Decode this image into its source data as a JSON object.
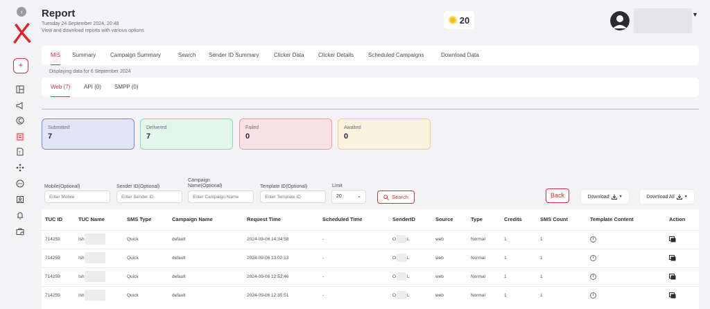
{
  "sidebar": {
    "collapse_icon": "chevron-right-icon",
    "add_label": "+",
    "icons": [
      "dashboard-icon",
      "megaphone-icon",
      "currency-icon",
      "report-icon",
      "template-icon",
      "network-icon",
      "chat-icon",
      "contact-icon",
      "bell-icon",
      "briefcase-icon"
    ]
  },
  "header": {
    "title": "Report",
    "date": "Tuesday 24 September 2024, 20:48",
    "subtitle": "View and download reports with various options",
    "credits": "20"
  },
  "tabs": [
    {
      "label": "MIS",
      "active": true
    },
    {
      "label": "Summary"
    },
    {
      "label": "Campaign Summary"
    },
    {
      "label": "Search"
    },
    {
      "label": "Sender ID Summary"
    },
    {
      "label": "Clicker Data"
    },
    {
      "label": "Clicker Details"
    },
    {
      "label": "Scheduled Campaigns"
    },
    {
      "label": "Download Data"
    }
  ],
  "display_info": "Displaying data for 6 September 2024",
  "subtabs": [
    {
      "label": "Web (7)",
      "active": true
    },
    {
      "label": "API (0)"
    },
    {
      "label": "SMPP (0)"
    }
  ],
  "stats": [
    {
      "label": "Submitted",
      "value": "7",
      "bg": "#e3e5f7",
      "border": "#7b83d8"
    },
    {
      "label": "Delivered",
      "value": "7",
      "bg": "#e2f6ec",
      "border": "#8bd9b0"
    },
    {
      "label": "Failed",
      "value": "0",
      "bg": "#f9e1e6",
      "border": "#e79aa9"
    },
    {
      "label": "Awaited",
      "value": "0",
      "bg": "#faf1de",
      "border": "#ebcf8f"
    }
  ],
  "filters": {
    "mobile_label": "Mobile(Optional)",
    "mobile_placeholder": "Enter Mobile",
    "sender_label": "Sender ID(Optional)",
    "sender_placeholder": "Enter Sender ID",
    "campaign_label_1": "Campaign",
    "campaign_label_2": "Name(Optional)",
    "campaign_placeholder": "Enter Campaign Name",
    "template_label": "Template ID(Optional)",
    "template_placeholder": "Enter Template ID",
    "limit_label": "Limit",
    "limit_value": "20",
    "search_label": "Search",
    "back_label": "Back",
    "download_label": "Download",
    "download_all_label": "Download All"
  },
  "table": {
    "headers": [
      "TUC ID",
      "TUC Name",
      "SMS Type",
      "Campaign Name",
      "Request Time",
      "Scheduled Time",
      "SenderID",
      "Source",
      "Type",
      "Credits",
      "SMS Count",
      "Template Content",
      "Action"
    ],
    "rows": [
      {
        "tuc_id": "714259",
        "tuc_name": "Ish",
        "sms_type": "Quick",
        "campaign": "default",
        "request_time": "2024-09-06 14:34:58",
        "scheduled": "-",
        "sender_a": "O",
        "sender_b": "L",
        "source": "web",
        "type": "Normal",
        "credits": "1",
        "count": "1"
      },
      {
        "tuc_id": "714259",
        "tuc_name": "Ish",
        "sms_type": "Quick",
        "campaign": "default",
        "request_time": "2024-09-06 13:02:13",
        "scheduled": "-",
        "sender_a": "O",
        "sender_b": "L",
        "source": "web",
        "type": "Normal",
        "credits": "1",
        "count": "1"
      },
      {
        "tuc_id": "714259",
        "tuc_name": "Ish",
        "sms_type": "Quick",
        "campaign": "default",
        "request_time": "2024-09-06 12:52:46",
        "scheduled": "-",
        "sender_a": "O",
        "sender_b": "L",
        "source": "web",
        "type": "Normal",
        "credits": "1",
        "count": "1"
      },
      {
        "tuc_id": "714259",
        "tuc_name": "Ish",
        "sms_type": "Quick",
        "campaign": "default",
        "request_time": "2024-09-06 12:35:51",
        "scheduled": "-",
        "sender_a": "O",
        "sender_b": "L",
        "source": "web",
        "type": "Normal",
        "credits": "1",
        "count": "1"
      }
    ]
  },
  "colors": {
    "accent": "#d2303a"
  }
}
